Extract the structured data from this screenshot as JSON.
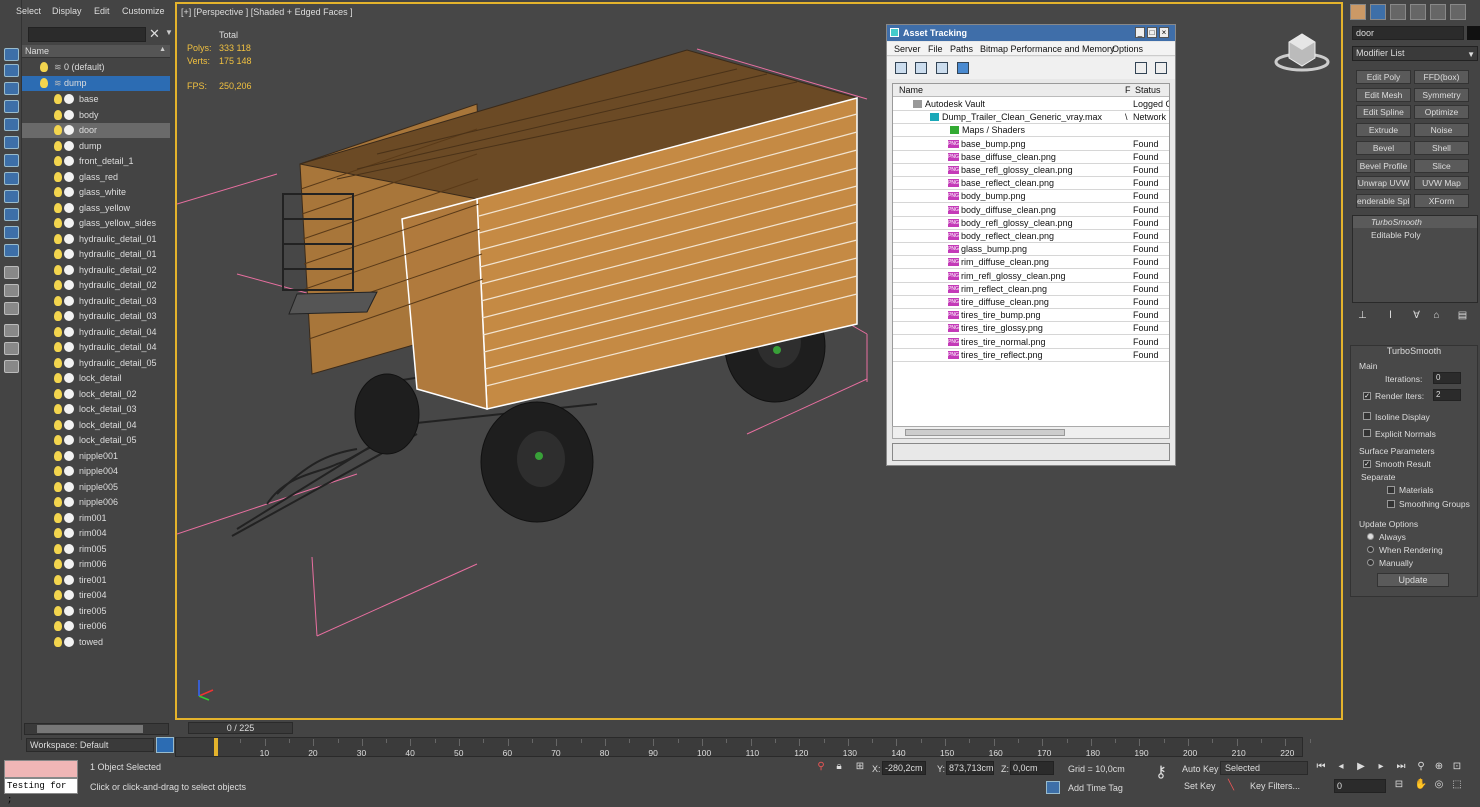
{
  "menu": [
    "Select",
    "Display",
    "Edit",
    "Customize"
  ],
  "explorer": {
    "column_header": "Name",
    "layers": [
      {
        "label": "0 (default)",
        "type": "layer"
      },
      {
        "label": "dump",
        "type": "layer",
        "selected": true
      }
    ],
    "objects": [
      "base",
      "body",
      "door",
      "dump",
      "front_detail_1",
      "glass_red",
      "glass_white",
      "glass_yellow",
      "glass_yellow_sides",
      "hydraulic_detail_01",
      "hydraulic_detail_01",
      "hydraulic_detail_02",
      "hydraulic_detail_02",
      "hydraulic_detail_03",
      "hydraulic_detail_03",
      "hydraulic_detail_04",
      "hydraulic_detail_04",
      "hydraulic_detail_05",
      "lock_detail",
      "lock_detail_02",
      "lock_detail_03",
      "lock_detail_04",
      "lock_detail_05",
      "nipple001",
      "nipple004",
      "nipple005",
      "nipple006",
      "rim001",
      "rim004",
      "rim005",
      "rim006",
      "tire001",
      "tire004",
      "tire005",
      "tire006",
      "towed"
    ],
    "highlighted_object": "door",
    "workspace": "Workspace: Default"
  },
  "viewport": {
    "label": "[+] [Perspective ] [Shaded + Edged Faces ]",
    "stats": {
      "total_label": "Total",
      "polys_label": "Polys:",
      "polys": "333 118",
      "verts_label": "Verts:",
      "verts": "175 148",
      "fps_label": "FPS:",
      "fps": "250,206"
    }
  },
  "asset_tracking": {
    "title": "Asset Tracking",
    "menu": [
      "Server",
      "File",
      "Paths",
      "Bitmap Performance and Memory",
      "Options"
    ],
    "col_name": "Name",
    "col_f": "F",
    "col_status": "Status",
    "rows": [
      {
        "name": "Autodesk Vault",
        "status": "Logged Out",
        "indent": 1
      },
      {
        "name": "Dump_Trailer_Clean_Generic_vray.max",
        "status": "Network",
        "indent": 2,
        "f": "\\"
      },
      {
        "name": "Maps / Shaders",
        "status": "",
        "indent": 3
      },
      {
        "name": "base_bump.png",
        "status": "Found",
        "indent": 4
      },
      {
        "name": "base_diffuse_clean.png",
        "status": "Found",
        "indent": 4
      },
      {
        "name": "base_refl_glossy_clean.png",
        "status": "Found",
        "indent": 4
      },
      {
        "name": "base_reflect_clean.png",
        "status": "Found",
        "indent": 4
      },
      {
        "name": "body_bump.png",
        "status": "Found",
        "indent": 4
      },
      {
        "name": "body_diffuse_clean.png",
        "status": "Found",
        "indent": 4
      },
      {
        "name": "body_refl_glossy_clean.png",
        "status": "Found",
        "indent": 4
      },
      {
        "name": "body_reflect_clean.png",
        "status": "Found",
        "indent": 4
      },
      {
        "name": "glass_bump.png",
        "status": "Found",
        "indent": 4
      },
      {
        "name": "rim_diffuse_clean.png",
        "status": "Found",
        "indent": 4
      },
      {
        "name": "rim_refl_glossy_clean.png",
        "status": "Found",
        "indent": 4
      },
      {
        "name": "rim_reflect_clean.png",
        "status": "Found",
        "indent": 4
      },
      {
        "name": "tire_diffuse_clean.png",
        "status": "Found",
        "indent": 4
      },
      {
        "name": "tires_tire_bump.png",
        "status": "Found",
        "indent": 4
      },
      {
        "name": "tires_tire_glossy.png",
        "status": "Found",
        "indent": 4
      },
      {
        "name": "tires_tire_normal.png",
        "status": "Found",
        "indent": 4
      },
      {
        "name": "tires_tire_reflect.png",
        "status": "Found",
        "indent": 4
      }
    ],
    "png_badge": "PNG"
  },
  "command_panel": {
    "object_name": "door",
    "modifier_list": "Modifier List",
    "buttons": [
      [
        "Edit Poly",
        "FFD(box)"
      ],
      [
        "Edit Mesh",
        "Symmetry"
      ],
      [
        "Edit Spline",
        "Optimize"
      ],
      [
        "Extrude",
        "Noise"
      ],
      [
        "Bevel",
        "Shell"
      ],
      [
        "Bevel Profile",
        "Slice"
      ],
      [
        "Unwrap UVW",
        "UVW Map"
      ],
      [
        "enderable Splir",
        "XForm"
      ]
    ],
    "stack": [
      "TurboSmooth",
      "Editable Poly"
    ],
    "turbosmooth": {
      "title": "TurboSmooth",
      "main": "Main",
      "iterations_label": "Iterations:",
      "iterations": "0",
      "render_iters_label": "Render Iters:",
      "render_iters": "2",
      "isoline": "Isoline Display",
      "explicit": "Explicit Normals",
      "surface": "Surface Parameters",
      "smooth_result": "Smooth Result",
      "separate": "Separate",
      "materials": "Materials",
      "smoothing_groups": "Smoothing Groups",
      "update_options": "Update Options",
      "always": "Always",
      "when_rendering": "When Rendering",
      "manually": "Manually",
      "update": "Update"
    }
  },
  "timeline": {
    "frame": "0 / 225",
    "ticks": [
      "10",
      "20",
      "30",
      "40",
      "50",
      "60",
      "70",
      "80",
      "90",
      "100",
      "110",
      "120",
      "130",
      "140",
      "150",
      "160",
      "170",
      "180",
      "190",
      "200",
      "210",
      "220"
    ]
  },
  "status": {
    "maxscript": "Testing for ;",
    "selected": "1 Object Selected",
    "prompt": "Click or click-and-drag to select objects",
    "x_label": "X:",
    "x": "-280,2cm",
    "y_label": "Y:",
    "y": "873,713cm",
    "z_label": "Z:",
    "z": "0,0cm",
    "grid": "Grid = 10,0cm",
    "add_time_tag": "Add Time Tag",
    "auto_key": "Auto Key",
    "set_key": "Set Key",
    "selected_dropdown": "Selected",
    "key_filters": "Key Filters...",
    "frame_field": "0"
  }
}
